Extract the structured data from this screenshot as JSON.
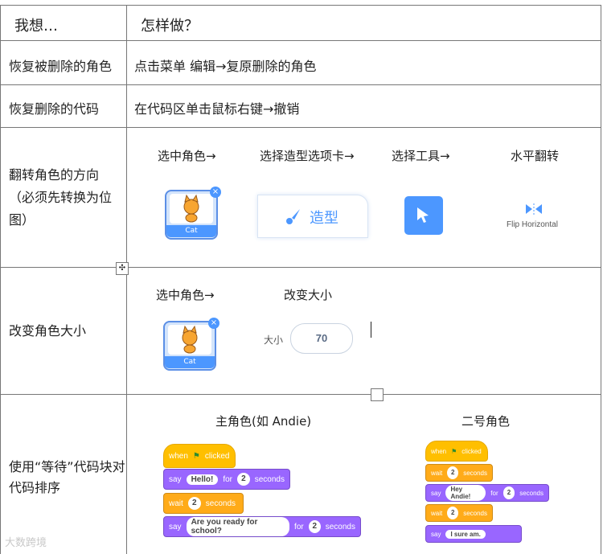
{
  "header": {
    "col1": "我想…",
    "col2": "怎样做？"
  },
  "rows": [
    {
      "want": "恢复被删除的角色",
      "how": "点击菜单  编辑→复原删除的角色"
    },
    {
      "want": "恢复删除的代码",
      "how": "在代码区单击鼠标右键→撤销"
    },
    {
      "want": "翻转角色的方向（必须先转换为位图）",
      "steps": [
        "选中角色→",
        "选择造型选项卡→",
        "选择工具→",
        "水平翻转"
      ],
      "sprite_name": "Cat",
      "costume_tab": "造型",
      "flip_label": "Flip Horizontal"
    },
    {
      "want": "改变角色大小",
      "steps": [
        "选中角色→",
        "改变大小"
      ],
      "sprite_name": "Cat",
      "size_label": "大小",
      "size_value": "70"
    },
    {
      "want": "使用“等待”代码块对代码排序",
      "main": {
        "title": "主角色(如  Andie)",
        "when": "when",
        "clicked": "clicked",
        "say1": "say",
        "say1_text": "Hello!",
        "for1": "for",
        "secs1": "2",
        "seconds1": "seconds",
        "wait": "wait",
        "wait_secs": "2",
        "wait_seconds": "seconds",
        "say2": "say",
        "say2_text": "Are you ready for school?",
        "for2": "for",
        "secs2": "2",
        "seconds2": "seconds"
      },
      "second": {
        "title": "二号角色",
        "when": "when",
        "clicked": "clicked",
        "wait1": "wait",
        "wait1_secs": "2",
        "wait1_seconds": "seconds",
        "say1": "say",
        "say1_text": "Hey Andie!",
        "for1": "for",
        "secs1": "2",
        "seconds1": "seconds",
        "wait2": "wait",
        "wait2_secs": "2",
        "wait2_seconds": "seconds",
        "say2": "say",
        "say2_text": "I sure am."
      }
    }
  ],
  "watermark": "大数跨境",
  "colors": {
    "events": "#ffbf00",
    "control": "#ffab19",
    "looks": "#9966ff",
    "accent": "#4c97ff"
  }
}
